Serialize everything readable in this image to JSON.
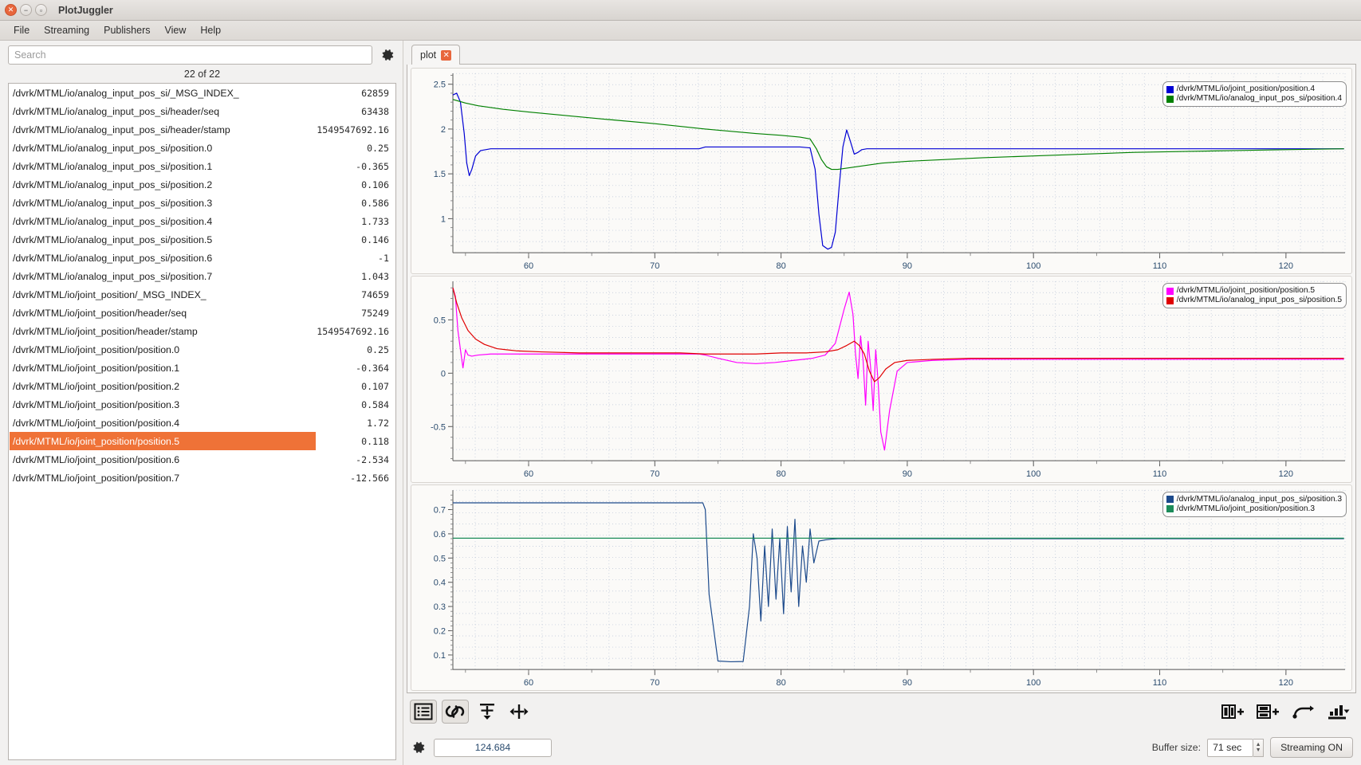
{
  "window": {
    "title": "PlotJuggler",
    "close_icon": "close-icon",
    "minimize_icon": "minimize-icon",
    "maximize_icon": "maximize-icon"
  },
  "menubar": {
    "items": [
      {
        "label": "File"
      },
      {
        "label": "Streaming"
      },
      {
        "label": "Publishers"
      },
      {
        "label": "View"
      },
      {
        "label": "Help"
      }
    ]
  },
  "sidebar": {
    "search": {
      "placeholder": "Search",
      "value": ""
    },
    "settings_icon": "gear-icon",
    "count_label": "22 of 22",
    "selected_index": 19,
    "items": [
      {
        "name": "/dvrk/MTML/io/analog_input_pos_si/_MSG_INDEX_",
        "value": "62859"
      },
      {
        "name": "/dvrk/MTML/io/analog_input_pos_si/header/seq",
        "value": "63438"
      },
      {
        "name": "/dvrk/MTML/io/analog_input_pos_si/header/stamp",
        "value": "1549547692.16"
      },
      {
        "name": "/dvrk/MTML/io/analog_input_pos_si/position.0",
        "value": "0.25"
      },
      {
        "name": "/dvrk/MTML/io/analog_input_pos_si/position.1",
        "value": "-0.365"
      },
      {
        "name": "/dvrk/MTML/io/analog_input_pos_si/position.2",
        "value": "0.106"
      },
      {
        "name": "/dvrk/MTML/io/analog_input_pos_si/position.3",
        "value": "0.586"
      },
      {
        "name": "/dvrk/MTML/io/analog_input_pos_si/position.4",
        "value": "1.733"
      },
      {
        "name": "/dvrk/MTML/io/analog_input_pos_si/position.5",
        "value": "0.146"
      },
      {
        "name": "/dvrk/MTML/io/analog_input_pos_si/position.6",
        "value": "-1"
      },
      {
        "name": "/dvrk/MTML/io/analog_input_pos_si/position.7",
        "value": "1.043"
      },
      {
        "name": "/dvrk/MTML/io/joint_position/_MSG_INDEX_",
        "value": "74659"
      },
      {
        "name": "/dvrk/MTML/io/joint_position/header/seq",
        "value": "75249"
      },
      {
        "name": "/dvrk/MTML/io/joint_position/header/stamp",
        "value": "1549547692.16"
      },
      {
        "name": "/dvrk/MTML/io/joint_position/position.0",
        "value": "0.25"
      },
      {
        "name": "/dvrk/MTML/io/joint_position/position.1",
        "value": "-0.364"
      },
      {
        "name": "/dvrk/MTML/io/joint_position/position.2",
        "value": "0.107"
      },
      {
        "name": "/dvrk/MTML/io/joint_position/position.3",
        "value": "0.584"
      },
      {
        "name": "/dvrk/MTML/io/joint_position/position.4",
        "value": "1.72"
      },
      {
        "name": "/dvrk/MTML/io/joint_position/position.5",
        "value": "0.118"
      },
      {
        "name": "/dvrk/MTML/io/joint_position/position.6",
        "value": "-2.534"
      },
      {
        "name": "/dvrk/MTML/io/joint_position/position.7",
        "value": "-12.566"
      }
    ]
  },
  "tabs": {
    "items": [
      {
        "label": "plot",
        "close_icon": "close-icon"
      }
    ],
    "active": 0
  },
  "toolbar": {
    "buttons": [
      {
        "name": "list-view-button",
        "icon": "list-icon",
        "active": true
      },
      {
        "name": "link-axes-button",
        "icon": "link-icon",
        "active": true
      },
      {
        "name": "vertical-fit-button",
        "icon": "arrow-down-bar-icon",
        "active": false
      },
      {
        "name": "horizontal-fit-button",
        "icon": "arrow-horizontal-icon",
        "active": false
      }
    ],
    "right_buttons": [
      {
        "name": "split-vertical-button",
        "icon": "split-columns-add-icon"
      },
      {
        "name": "split-horizontal-button",
        "icon": "split-rows-add-icon"
      },
      {
        "name": "undo-button",
        "icon": "undo-arrow-icon"
      },
      {
        "name": "export-button",
        "icon": "export-icon"
      }
    ]
  },
  "status": {
    "settings_icon": "gear-icon",
    "time_value": "124.684",
    "buffer_label": "Buffer size:",
    "buffer_value": "71 sec",
    "streaming_button": "Streaming ON"
  },
  "colors": {
    "accent_selection": "#ef7237",
    "blue": "#0000d4",
    "green": "#008000",
    "magenta": "#ff00ff",
    "red": "#e00000",
    "navy": "#1c4a8c",
    "tick_text": "#2a4b6e"
  },
  "chart_data": [
    {
      "type": "line",
      "id": "plot-1",
      "title": "",
      "xlabel": "",
      "ylabel": "",
      "xlim": [
        54.0,
        124.684
      ],
      "ylim": [
        0.62,
        2.62
      ],
      "xticks": [
        60,
        70,
        80,
        90,
        100,
        110,
        120
      ],
      "yticks": [
        1,
        1.5,
        2,
        2.5
      ],
      "grid": true,
      "legend_position": "top-right",
      "series": [
        {
          "name": "/dvrk/MTML/io/joint_position/position.4",
          "color": "#0000d4",
          "x": [
            54.0,
            54.3,
            54.6,
            54.9,
            55.1,
            55.3,
            55.5,
            55.8,
            56.2,
            57.0,
            58.0,
            60.0,
            65.0,
            70.0,
            73.5,
            74.0,
            74.5,
            76.0,
            78.0,
            80.0,
            81.5,
            82.3,
            82.7,
            83.0,
            83.3,
            83.7,
            84.0,
            84.3,
            84.6,
            84.9,
            85.2,
            85.5,
            85.8,
            86.1,
            86.4,
            86.8,
            87.2,
            87.8,
            88.5,
            90.0,
            95.0,
            100.0,
            105.0,
            110.0,
            115.0,
            120.0,
            124.6
          ],
          "y": [
            2.38,
            2.4,
            2.3,
            1.95,
            1.62,
            1.48,
            1.55,
            1.7,
            1.76,
            1.78,
            1.78,
            1.78,
            1.78,
            1.78,
            1.78,
            1.8,
            1.8,
            1.8,
            1.8,
            1.8,
            1.8,
            1.79,
            1.55,
            1.05,
            0.7,
            0.66,
            0.68,
            0.85,
            1.35,
            1.8,
            1.99,
            1.86,
            1.72,
            1.74,
            1.77,
            1.78,
            1.78,
            1.78,
            1.78,
            1.78,
            1.78,
            1.78,
            1.78,
            1.78,
            1.78,
            1.78,
            1.78
          ]
        },
        {
          "name": "/dvrk/MTML/io/analog_input_pos_si/position.4",
          "color": "#008000",
          "x": [
            54.0,
            54.5,
            55.0,
            56.0,
            58.0,
            60.0,
            63.0,
            66.0,
            70.0,
            74.0,
            78.0,
            80.0,
            81.5,
            82.3,
            82.8,
            83.2,
            83.6,
            84.0,
            84.5,
            85.0,
            86.0,
            87.0,
            88.0,
            90.0,
            93.0,
            96.0,
            100.0,
            104.0,
            108.0,
            112.0,
            116.0,
            120.0,
            124.6
          ],
          "y": [
            2.33,
            2.31,
            2.29,
            2.26,
            2.22,
            2.19,
            2.15,
            2.11,
            2.06,
            2.0,
            1.95,
            1.93,
            1.91,
            1.89,
            1.78,
            1.66,
            1.58,
            1.55,
            1.55,
            1.56,
            1.58,
            1.6,
            1.62,
            1.64,
            1.66,
            1.68,
            1.7,
            1.72,
            1.74,
            1.75,
            1.76,
            1.77,
            1.78
          ]
        }
      ]
    },
    {
      "type": "line",
      "id": "plot-2",
      "title": "",
      "xlabel": "",
      "ylabel": "",
      "xlim": [
        54.0,
        124.684
      ],
      "ylim": [
        -0.82,
        0.86
      ],
      "xticks": [
        60,
        70,
        80,
        90,
        100,
        110,
        120
      ],
      "yticks": [
        -0.5,
        0,
        0.5
      ],
      "grid": true,
      "legend_position": "top-right",
      "series": [
        {
          "name": "/dvrk/MTML/io/joint_position/position.5",
          "color": "#ff00ff",
          "x": [
            54.0,
            54.2,
            54.4,
            54.6,
            54.8,
            55.0,
            55.2,
            55.5,
            56.0,
            57.0,
            58.0,
            60.0,
            65.0,
            70.0,
            73.5,
            74.0,
            75.0,
            76.5,
            78.0,
            79.5,
            81.0,
            82.5,
            83.5,
            84.3,
            85.0,
            85.4,
            85.7,
            85.9,
            86.1,
            86.3,
            86.5,
            86.7,
            86.9,
            87.1,
            87.3,
            87.5,
            87.7,
            87.9,
            88.2,
            88.6,
            89.2,
            90.0,
            92.0,
            95.0,
            100.0,
            106.0,
            112.0,
            118.0,
            124.6
          ],
          "y": [
            0.8,
            0.72,
            0.4,
            0.22,
            0.05,
            0.22,
            0.17,
            0.16,
            0.17,
            0.18,
            0.18,
            0.18,
            0.18,
            0.18,
            0.18,
            0.17,
            0.14,
            0.1,
            0.09,
            0.1,
            0.12,
            0.14,
            0.17,
            0.28,
            0.6,
            0.76,
            0.55,
            0.18,
            -0.05,
            0.35,
            0.12,
            -0.3,
            0.3,
            0.05,
            -0.35,
            0.22,
            -0.1,
            -0.55,
            -0.72,
            -0.35,
            0.02,
            0.1,
            0.12,
            0.13,
            0.13,
            0.13,
            0.13,
            0.13,
            0.13
          ]
        },
        {
          "name": "/dvrk/MTML/io/analog_input_pos_si/position.5",
          "color": "#e00000",
          "x": [
            54.0,
            54.3,
            54.7,
            55.2,
            55.8,
            56.5,
            57.5,
            59.0,
            61.0,
            64.0,
            68.0,
            72.0,
            74.0,
            76.0,
            78.0,
            80.0,
            82.0,
            83.5,
            84.5,
            85.2,
            85.8,
            86.2,
            86.6,
            87.0,
            87.4,
            87.8,
            88.3,
            89.0,
            90.0,
            92.0,
            95.0,
            100.0,
            106.0,
            112.0,
            118.0,
            124.6
          ],
          "y": [
            0.8,
            0.66,
            0.52,
            0.4,
            0.32,
            0.27,
            0.23,
            0.21,
            0.2,
            0.19,
            0.19,
            0.19,
            0.18,
            0.18,
            0.18,
            0.19,
            0.19,
            0.2,
            0.22,
            0.26,
            0.3,
            0.26,
            0.18,
            0.02,
            -0.08,
            -0.04,
            0.04,
            0.1,
            0.12,
            0.13,
            0.14,
            0.14,
            0.14,
            0.14,
            0.14,
            0.14
          ]
        }
      ]
    },
    {
      "type": "line",
      "id": "plot-3",
      "title": "",
      "xlabel": "",
      "ylabel": "",
      "xlim": [
        54.0,
        124.684
      ],
      "ylim": [
        0.04,
        0.78
      ],
      "xticks": [
        60,
        70,
        80,
        90,
        100,
        110,
        120
      ],
      "yticks": [
        0.1,
        0.2,
        0.3,
        0.4,
        0.5,
        0.6,
        0.7
      ],
      "grid": true,
      "legend_position": "top-right",
      "series": [
        {
          "name": "/dvrk/MTML/io/analog_input_pos_si/position.3",
          "color": "#1c4a8c",
          "x": [
            54.0,
            60.0,
            66.0,
            70.0,
            73.0,
            73.8,
            74.0,
            74.3,
            75.0,
            76.0,
            77.0,
            77.5,
            77.8,
            78.1,
            78.4,
            78.7,
            79.0,
            79.3,
            79.6,
            79.9,
            80.2,
            80.5,
            80.8,
            81.1,
            81.4,
            81.7,
            82.0,
            82.3,
            82.6,
            83.0,
            83.5,
            84.0,
            84.5,
            85.0,
            86.0,
            88.0,
            92.0,
            98.0,
            105.0,
            112.0,
            118.0,
            124.6
          ],
          "y": [
            0.728,
            0.728,
            0.728,
            0.728,
            0.728,
            0.728,
            0.7,
            0.35,
            0.075,
            0.072,
            0.073,
            0.3,
            0.6,
            0.5,
            0.24,
            0.55,
            0.3,
            0.62,
            0.33,
            0.58,
            0.27,
            0.63,
            0.36,
            0.66,
            0.3,
            0.55,
            0.4,
            0.62,
            0.48,
            0.57,
            0.575,
            0.578,
            0.58,
            0.58,
            0.58,
            0.58,
            0.58,
            0.58,
            0.58,
            0.58,
            0.58,
            0.58
          ]
        },
        {
          "name": "/dvrk/MTML/io/joint_position/position.3",
          "color": "#1c8c5a",
          "x": [
            54.0,
            60.0,
            70.0,
            74.0,
            80.0,
            85.0,
            90.0,
            100.0,
            110.0,
            120.0,
            124.6
          ],
          "y": [
            0.582,
            0.582,
            0.582,
            0.582,
            0.582,
            0.582,
            0.582,
            0.582,
            0.582,
            0.582,
            0.582
          ]
        }
      ]
    }
  ]
}
